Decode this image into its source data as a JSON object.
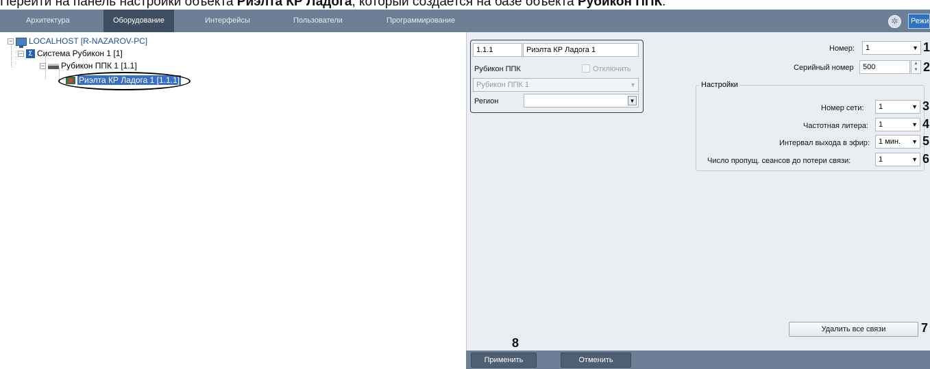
{
  "caption": {
    "prefix": "Перейти на панель настройки объекта ",
    "bold1": "Риэлта КР Ладога",
    "middle": ", который создается на базе объекта ",
    "bold2": "Рубикон ППК",
    "suffix": "."
  },
  "topbar": {
    "tabs": [
      "Архитектура",
      "Оборудование",
      "Интерфейсы",
      "Пользователи",
      "Программирование"
    ],
    "active_tab": "Оборудование",
    "mode_button": "Режим"
  },
  "tree": {
    "items": [
      {
        "label": "LOCALHOST [R-NAZAROV-PC]",
        "icon": "computer-icon"
      },
      {
        "label": "Система Рубикон 1 [1]",
        "icon": "rubicon-system-icon"
      },
      {
        "label": "Рубикон ППК 1 [1.1]",
        "icon": "ppk-device-icon"
      },
      {
        "label": "Риэлта КР Ладога 1 [1.1.1]",
        "icon": "radio-device-icon",
        "selected": true
      }
    ]
  },
  "object_panel": {
    "id": "1.1.1",
    "name": "Риэлта КР Ладога 1",
    "parent_label": "Рубикон ППК",
    "disable_label": "Отключить",
    "parent_value": "Рубикон ППК 1",
    "region_label": "Регион",
    "region_value": ""
  },
  "settings": {
    "number_label": "Номер:",
    "number_value": "1",
    "serial_label": "Серийный номер",
    "serial_value": "500",
    "group_title": "Настройки",
    "network_label": "Номер сети:",
    "network_value": "1",
    "letter_label": "Частотная литера:",
    "letter_value": "1",
    "interval_label": "Интервал выхода в эфир:",
    "interval_value": "1 мин.",
    "missed_label": "Число пропущ. сеансов до потери связи:",
    "missed_value": "1",
    "delete_links_button": "Удалить все связи"
  },
  "callouts": [
    "1",
    "2",
    "3",
    "4",
    "5",
    "6",
    "7",
    "8"
  ],
  "footer": {
    "apply_button": "Применить",
    "cancel_button": "Отменить"
  },
  "colors": {
    "topbar": "#6c7f96",
    "active_tab": "#3f4f63",
    "panel_bg": "#eaedf1",
    "selection": "#3a6fc6",
    "mode_button": "#2d73bf"
  }
}
